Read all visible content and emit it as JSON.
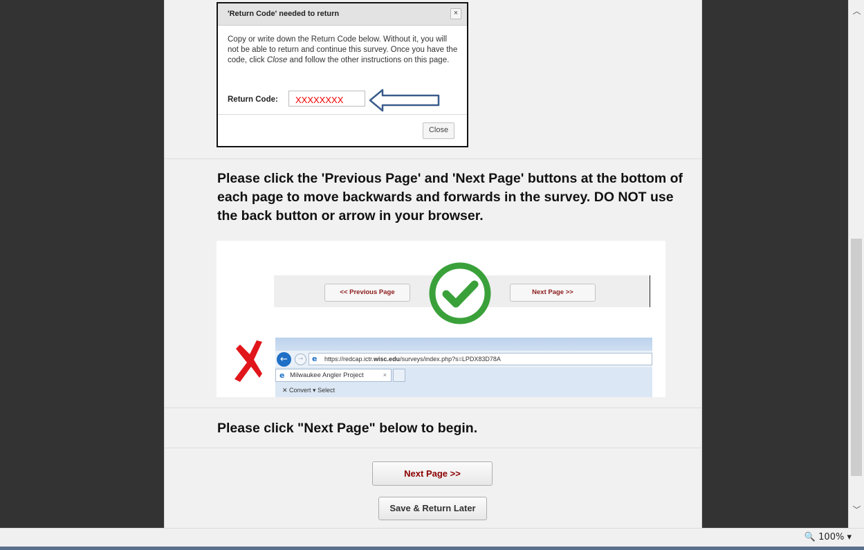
{
  "dialog": {
    "title": "'Return Code' needed to return",
    "close_x": "×",
    "body_text": "Copy or write down the Return Code below. Without it, you will not be able to return and continue this survey. Once you have the code, click",
    "body_italic": "Close",
    "body_text_end": "and follow the other instructions on this page.",
    "code_label": "Return Code:",
    "code_value": "XXXXXXXX",
    "close_button": "Close"
  },
  "instructions": "Please click the 'Previous Page' and 'Next Page' buttons at the bottom of each page to move backwards and forwards in the survey. DO NOT use the back button or arrow in your browser.",
  "nav_image": {
    "prev_label": "<< Previous Page",
    "next_label": "Next Page >>",
    "url_scheme": "https://redcap.ictr.",
    "url_domain": "wisc.edu",
    "url_path": "/surveys/index.php?s=LPDX83D78A",
    "tab_title": "Milwaukee Angler Project",
    "tab_close": "×",
    "cmd_items": "✕    Convert ▾  Select"
  },
  "begin_text": "Please click \"Next Page\" below to begin.",
  "buttons": {
    "next": "Next Page >>",
    "save": "Save & Return Later"
  },
  "status_bar": {
    "zoom": "🔍 100%  ▾"
  },
  "colors": {
    "page_bg": "#f1f1f1",
    "outer_bg": "#333333",
    "next_text": "#8b0000",
    "code_red": "#ee0000",
    "check_green": "#3aa13a",
    "x_red": "#e0161b"
  }
}
